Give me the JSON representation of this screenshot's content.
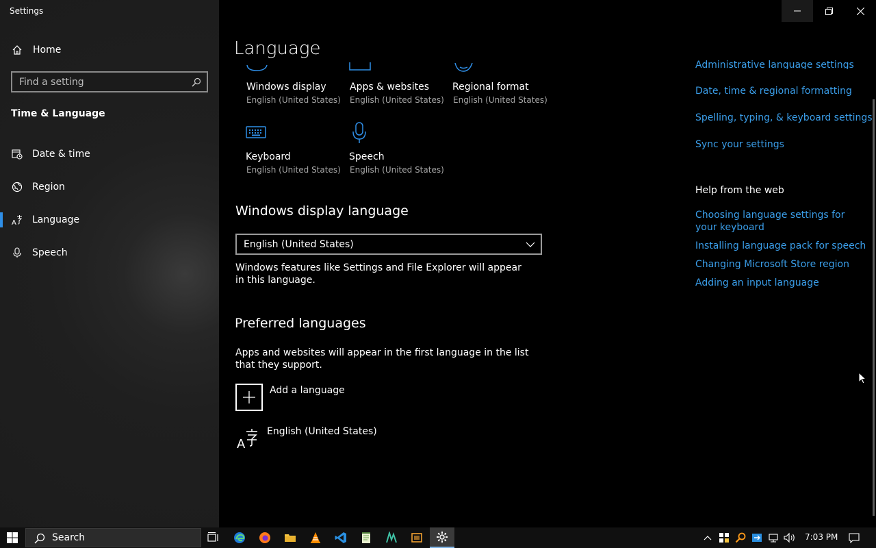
{
  "window": {
    "app_title": "Settings",
    "controls": [
      "minimize",
      "restore",
      "close"
    ]
  },
  "sidebar": {
    "home_label": "Home",
    "search_placeholder": "Find a setting",
    "section_title": "Time & Language",
    "items": [
      {
        "label": "Date & time",
        "icon": "calendar-clock-icon"
      },
      {
        "label": "Region",
        "icon": "globe-icon"
      },
      {
        "label": "Language",
        "icon": "language-icon",
        "active": true
      },
      {
        "label": "Speech",
        "icon": "microphone-icon"
      }
    ]
  },
  "main": {
    "title": "Language",
    "tiles": [
      {
        "title": "Windows display",
        "subtitle": "English (United States)",
        "icon": "display-icon"
      },
      {
        "title": "Apps & websites",
        "subtitle": "English (United States)",
        "icon": "apps-icon"
      },
      {
        "title": "Regional format",
        "subtitle": "English (United States)",
        "icon": "globe-icon"
      },
      {
        "title": "Keyboard",
        "subtitle": "English (United States)",
        "icon": "keyboard-icon"
      },
      {
        "title": "Speech",
        "subtitle": "English (United States)",
        "icon": "microphone-icon"
      }
    ],
    "display_language": {
      "heading": "Windows display language",
      "selected": "English (United States)",
      "description": "Windows features like Settings and File Explorer will appear in this language."
    },
    "preferred": {
      "heading": "Preferred languages",
      "description": "Apps and websites will appear in the first language in the list that they support.",
      "add_label": "Add a language",
      "languages": [
        "English (United States)"
      ]
    }
  },
  "related": {
    "links_top": [
      "Administrative language settings",
      "Date, time & regional formatting",
      "Spelling, typing, & keyboard settings",
      "Sync your settings"
    ],
    "help_heading": "Help from the web",
    "help_links": [
      "Choosing language settings for your keyboard",
      "Installing language pack for speech",
      "Changing Microsoft Store region",
      "Adding an input language"
    ]
  },
  "taskbar": {
    "search_label": "Search",
    "apps": [
      "task-view",
      "edge",
      "firefox",
      "file-explorer",
      "vlc",
      "vscode",
      "notepad",
      "app",
      "virtualbox",
      "settings"
    ],
    "clock": "7:03 PM"
  },
  "colors": {
    "accent": "#2f8fe8",
    "link": "#3a9de8",
    "sidebar_bg": "#1f1f1f",
    "main_bg": "#000000"
  }
}
